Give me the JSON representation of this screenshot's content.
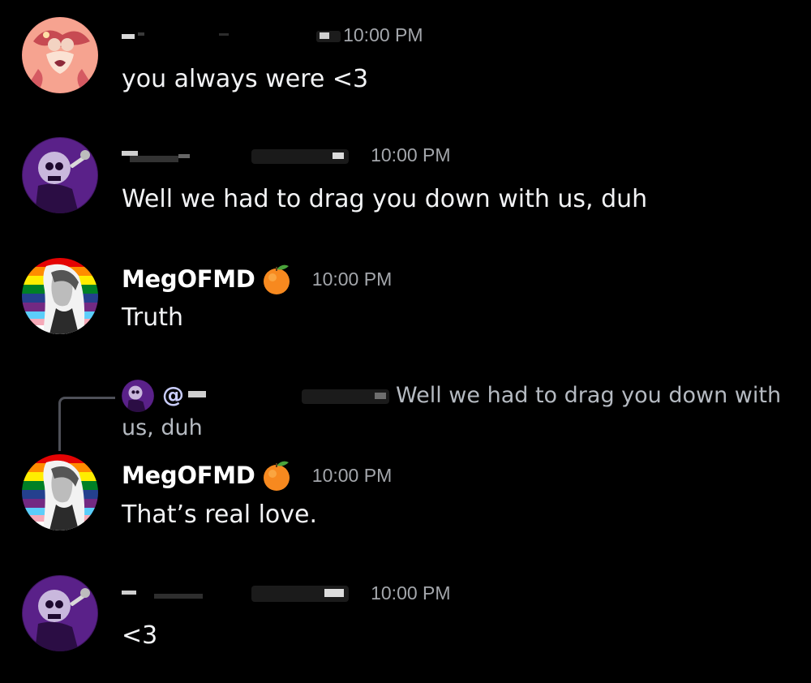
{
  "messages": [
    {
      "author": "",
      "author_redacted": true,
      "timestamp": "10:00 PM",
      "text": "you always were <3",
      "avatar": "pink-character-avatar"
    },
    {
      "author": "",
      "author_redacted": true,
      "timestamp": "10:00 PM",
      "text": "Well we had to drag you down with us, duh",
      "avatar": "purple-skull-singer-avatar"
    },
    {
      "author": "MegOFMD",
      "author_badge": "orange-icon",
      "timestamp": "10:00 PM",
      "text": "Truth",
      "avatar": "pride-flag-portrait-avatar"
    },
    {
      "author": "MegOFMD",
      "author_badge": "orange-icon",
      "timestamp": "10:00 PM",
      "text": "That’s real love.",
      "avatar": "pride-flag-portrait-avatar",
      "reply_to": {
        "mention_prefix": "@",
        "mention_redacted": true,
        "text_line_1": "Well we had to drag you down with",
        "text_line_2": "us, duh"
      }
    },
    {
      "author": "",
      "author_redacted": true,
      "timestamp": "10:00 PM",
      "text": "<3",
      "avatar": "purple-skull-singer-avatar"
    }
  ],
  "colors": {
    "background": "#000000",
    "username": "#ffffff",
    "timestamp": "#a3a6ab",
    "message_text": "#f2f3f5",
    "reply_text": "#b5bac1",
    "reply_spine": "#4e5058"
  }
}
